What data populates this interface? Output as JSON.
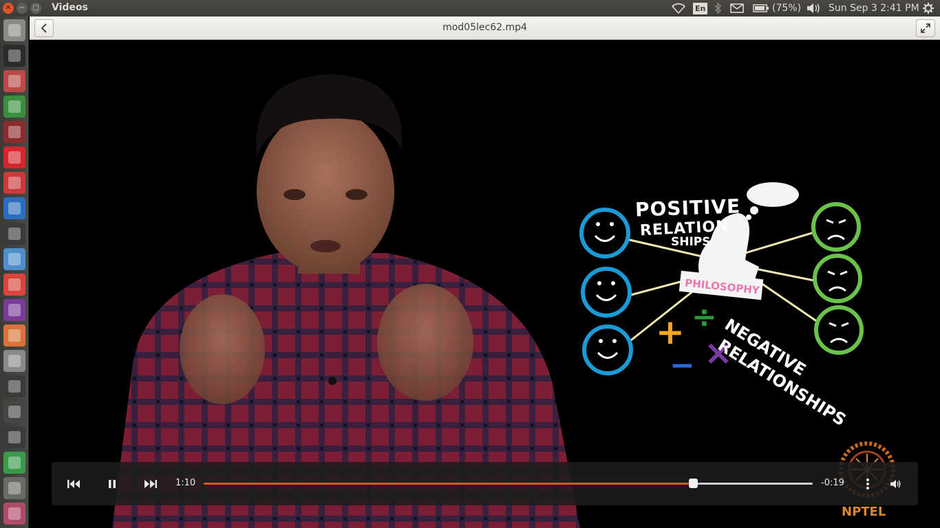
{
  "panel": {
    "app_title": "Videos",
    "keyboard_layout": "En",
    "battery_text": "(75%)",
    "datetime": "Sun Sep  3  2:41 PM"
  },
  "header": {
    "file_name": "mod05lec62.mp4"
  },
  "video": {
    "slide": {
      "label_positive": "POSITIVE",
      "label_relation": "RELATION",
      "label_ships": "SHIPS",
      "label_philosophy": "PHILOSOPHY",
      "label_negative": "NEGATIVE",
      "label_relationships": "RELATIONSHIPS",
      "operators": [
        "+",
        "÷",
        "−",
        "×"
      ]
    },
    "watermark": "NPTEL"
  },
  "player": {
    "elapsed": "1:10",
    "remaining": "-0:19",
    "progress": 0.803
  },
  "launcher_items": [
    {
      "name": "dash-home",
      "icon": "ubuntu-logo-icon",
      "color": "#8a8a85"
    },
    {
      "name": "terminal",
      "icon": "terminal-icon",
      "color": "#2b2b2b"
    },
    {
      "name": "files",
      "icon": "archive-icon",
      "color": "#b94a48"
    },
    {
      "name": "chrome",
      "icon": "chrome-icon",
      "color": "#3b8e3d"
    },
    {
      "name": "app-red",
      "icon": "gear-red-icon",
      "color": "#8c2b2b"
    },
    {
      "name": "opera",
      "icon": "opera-icon",
      "color": "#d4262c"
    },
    {
      "name": "viewer",
      "icon": "document-viewer-icon",
      "color": "#c93a3a"
    },
    {
      "name": "r-lang",
      "icon": "r-icon",
      "color": "#2a6ebd"
    },
    {
      "name": "video-editor",
      "icon": "clapper-icon",
      "color": "#3a3a3a"
    },
    {
      "name": "writer",
      "icon": "document-icon",
      "color": "#4d8fcc"
    },
    {
      "name": "gmail",
      "icon": "gmail-icon",
      "color": "#d9443c"
    },
    {
      "name": "media",
      "icon": "film-icon",
      "color": "#7a3c9a"
    },
    {
      "name": "impress",
      "icon": "presentation-icon",
      "color": "#d9733a"
    },
    {
      "name": "text-editor",
      "icon": "pencil-icon",
      "color": "#8a8a8a"
    },
    {
      "name": "sublime",
      "icon": "sublime-icon",
      "color": "#3a3a3a"
    },
    {
      "name": "ipython",
      "icon": "ipython-icon",
      "color": "#444"
    },
    {
      "name": "gp",
      "icon": "gp-icon",
      "color": "#3a3a3a"
    },
    {
      "name": "calc",
      "icon": "spreadsheet-icon",
      "color": "#3a9a4a"
    },
    {
      "name": "drive",
      "icon": "drive-icon",
      "color": "#6a6a66"
    },
    {
      "name": "more",
      "icon": "stack-icon",
      "color": "#b04a6a"
    }
  ]
}
